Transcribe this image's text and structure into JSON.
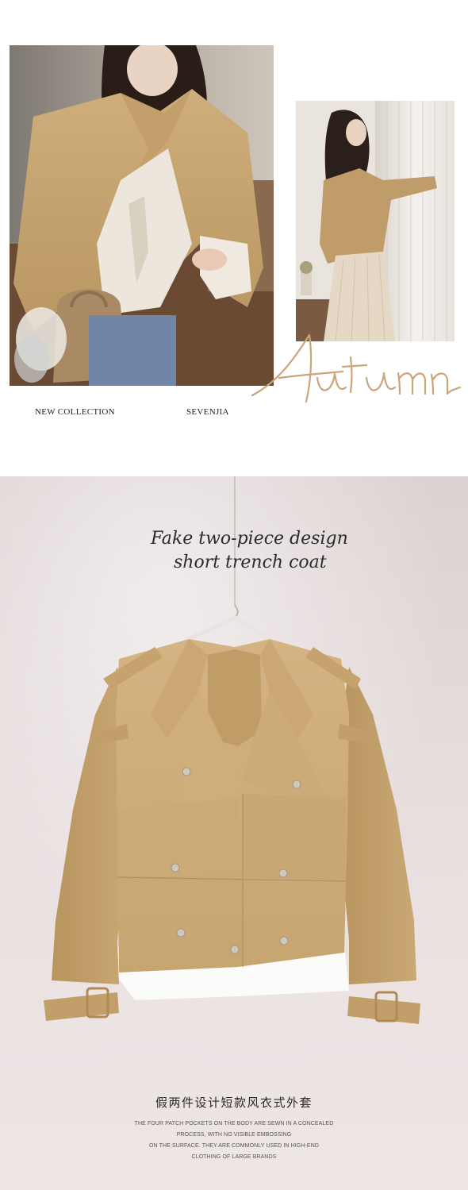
{
  "top": {
    "caption_left": "NEW COLLECTION",
    "caption_right": "SEVENJIA",
    "script_word": "Autumn"
  },
  "product": {
    "headline_line1": "Fake two-piece design",
    "headline_line2": "short trench coat",
    "title_cn": "假两件设计短款风衣式外套",
    "description_lines": [
      "THE FOUR PATCH POCKETS ON THE BODY ARE SEWN IN A CONCEALED",
      "PROCESS, WITH NO VISIBLE EMBOSSING",
      "ON THE SURFACE. THEY ARE COMMONLY USED IN HIGH-END",
      "CLOTHING OF LARGE BRANDS"
    ]
  },
  "colors": {
    "coat_khaki": "#cfae7c",
    "coat_shadow": "#b8955f",
    "script_gold": "#c9a57a",
    "panel_bg": "#e6dcdc"
  }
}
